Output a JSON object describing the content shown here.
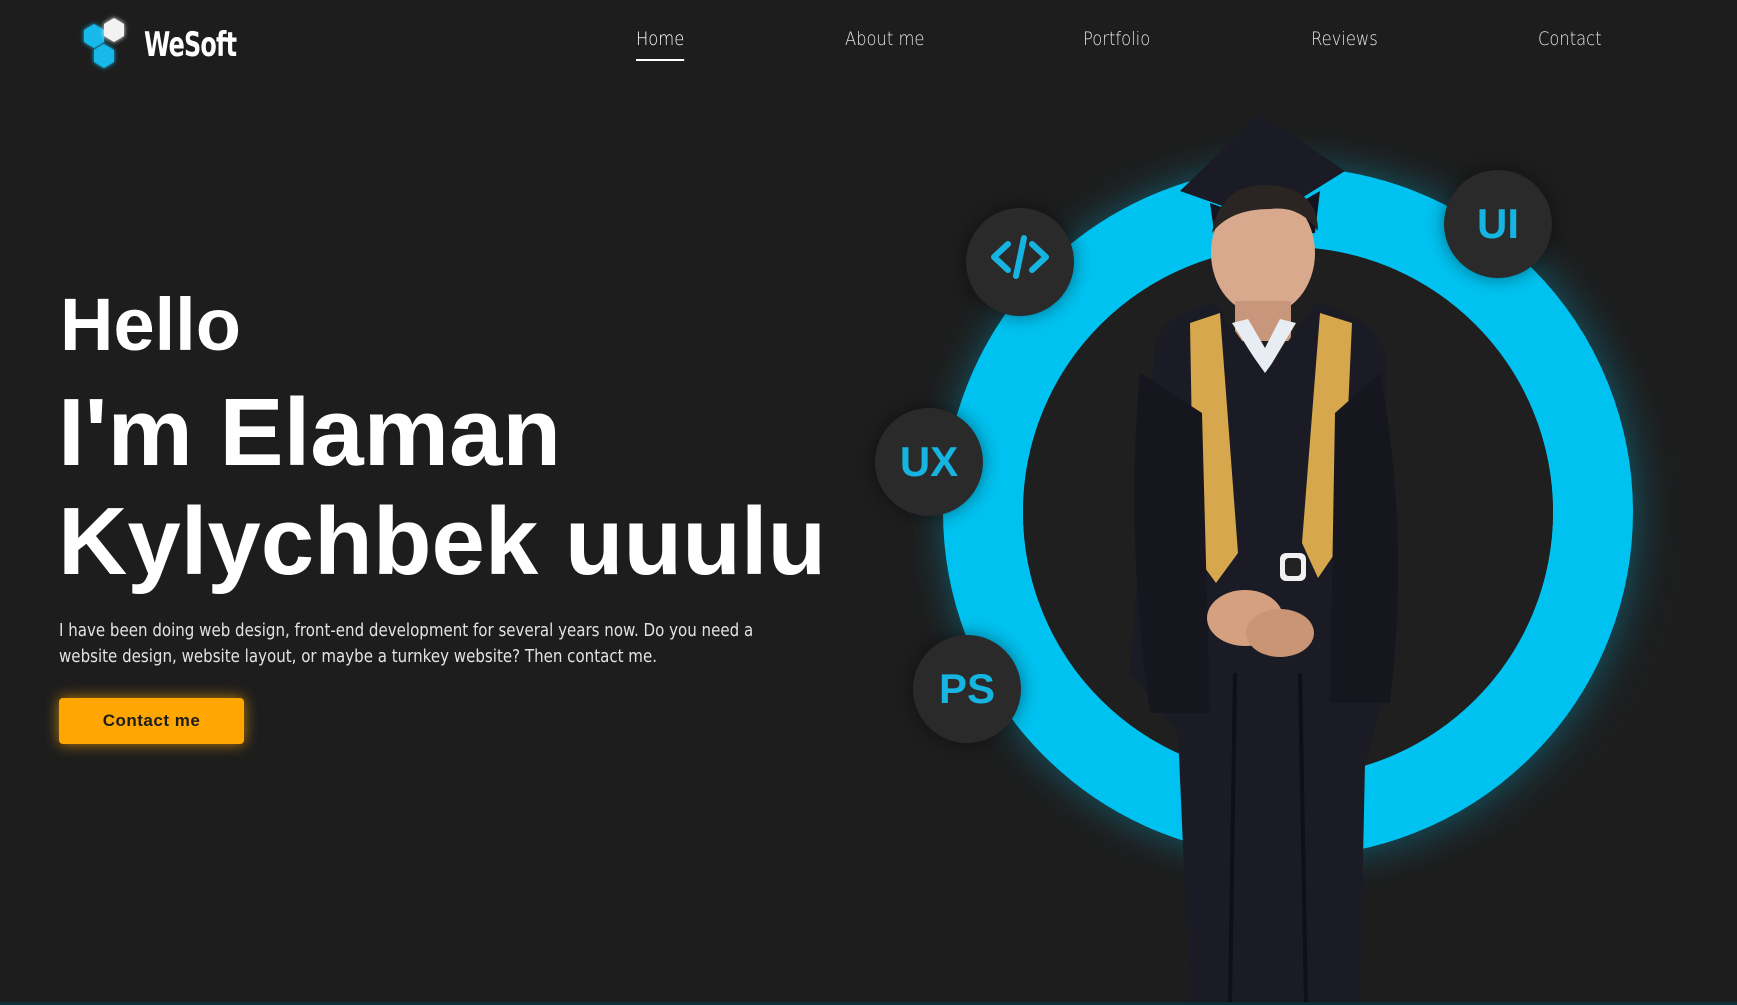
{
  "brand": {
    "name": "WeSoft",
    "logo_icon": "hexagon-cluster-icon"
  },
  "nav": {
    "items": [
      {
        "label": "Home",
        "active": true
      },
      {
        "label": "About me",
        "active": false
      },
      {
        "label": "Portfolio",
        "active": false
      },
      {
        "label": "Reviews",
        "active": false
      },
      {
        "label": "Contact",
        "active": false
      }
    ]
  },
  "hero": {
    "greeting": "Hello",
    "name_line_1": "I'm Elaman",
    "name_line_2": "Kylychbek uuulu",
    "description": "I have been doing web design, front-end development for several years now. Do you need a website design, website layout, or maybe a turnkey website? Then contact me.",
    "cta_label": "Contact me"
  },
  "skills": {
    "code": {
      "label": "</>",
      "icon": "code-icon"
    },
    "ui": {
      "label": "UI"
    },
    "ux": {
      "label": "UX"
    },
    "ps": {
      "label": "PS"
    }
  },
  "colors": {
    "background": "#1d1d1d",
    "accent_blue": "#00c2f0",
    "cta_orange": "#ffa600"
  }
}
